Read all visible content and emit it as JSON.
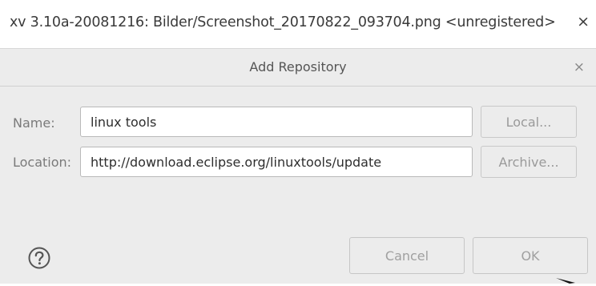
{
  "viewer": {
    "title": "xv 3.10a-20081216: Bilder/Screenshot_20170822_093704.png <unregistered>",
    "close_glyph": "×"
  },
  "dialog": {
    "title": "Add Repository",
    "close_glyph": "×"
  },
  "form": {
    "name_label": "Name:",
    "name_value": "linux tools",
    "location_label": "Location:",
    "location_value": "http://download.eclipse.org/linuxtools/update",
    "local_button": "Local...",
    "archive_button": "Archive..."
  },
  "footer": {
    "help_icon": "question-circle-icon",
    "cancel_button": "Cancel",
    "ok_button": "OK"
  },
  "colors": {
    "dialog_background": "#ececec",
    "field_border": "#b9b9b9",
    "disabled_text": "#a0a0a0"
  }
}
